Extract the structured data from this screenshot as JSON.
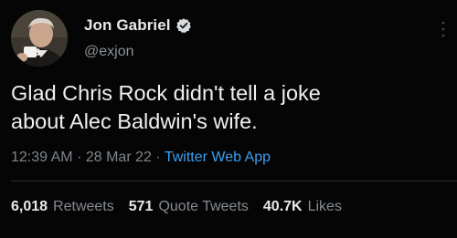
{
  "author": {
    "name": "Jon Gabriel",
    "handle": "@exjon",
    "avatar_icon": "person-avatar-icon",
    "verified_icon": "verified-badge-icon"
  },
  "tweet": {
    "text_line1": "Glad Chris Rock didn't tell a joke",
    "text_line2": "about Alec Baldwin's wife.",
    "time": "12:39 AM",
    "date": "28 Mar 22",
    "separator": "·",
    "source": "Twitter Web App"
  },
  "stats": {
    "retweets_count": "6,018",
    "retweets_label": "Retweets",
    "quotes_count": "571",
    "quotes_label": "Quote Tweets",
    "likes_count": "40.7K",
    "likes_label": "Likes"
  },
  "colors": {
    "background": "#050505",
    "link": "#3d9ff0",
    "text": "#e7e9ea",
    "muted": "#7f858b"
  }
}
